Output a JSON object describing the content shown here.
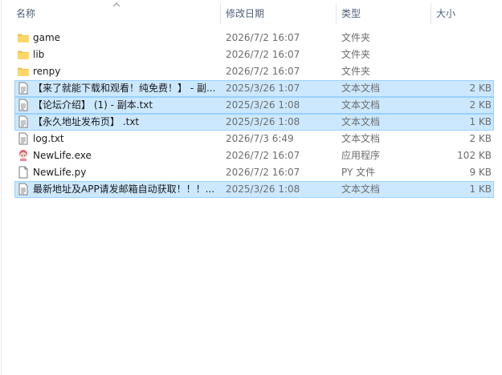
{
  "columns": {
    "name": "名称",
    "date": "修改日期",
    "type": "类型",
    "size": "大小"
  },
  "sort": {
    "column": "name",
    "direction": "ascending",
    "icon": "chevron-up-icon"
  },
  "files": [
    {
      "name": "game",
      "date": "2026/7/2 16:07",
      "type": "文件夹",
      "size": "",
      "icon": "folder-icon",
      "selected": false
    },
    {
      "name": "lib",
      "date": "2026/7/2 16:07",
      "type": "文件夹",
      "size": "",
      "icon": "folder-icon",
      "selected": false
    },
    {
      "name": "renpy",
      "date": "2026/7/2 16:07",
      "type": "文件夹",
      "size": "",
      "icon": "folder-icon",
      "selected": false
    },
    {
      "name": "【来了就能下载和观看！纯免费！】 - 副...",
      "date": "2025/3/26 1:07",
      "type": "文本文档",
      "size": "2 KB",
      "icon": "text-file-icon",
      "selected": true
    },
    {
      "name": "【论坛介绍】 (1) - 副本.txt",
      "date": "2025/3/26 1:08",
      "type": "文本文档",
      "size": "2 KB",
      "icon": "text-file-icon",
      "selected": true
    },
    {
      "name": "【永久地址发布页】 .txt",
      "date": "2025/3/26 1:08",
      "type": "文本文档",
      "size": "1 KB",
      "icon": "text-file-icon",
      "selected": true
    },
    {
      "name": "log.txt",
      "date": "2026/7/3 6:49",
      "type": "文本文档",
      "size": "2 KB",
      "icon": "text-file-icon",
      "selected": false
    },
    {
      "name": "NewLife.exe",
      "date": "2026/7/2 16:07",
      "type": "应用程序",
      "size": "102 KB",
      "icon": "app-icon",
      "selected": false
    },
    {
      "name": "NewLife.py",
      "date": "2026/7/2 16:07",
      "type": "PY 文件",
      "size": "9 KB",
      "icon": "blank-file-icon",
      "selected": false
    },
    {
      "name": "最新地址及APP请发邮箱自动获取！！！...",
      "date": "2025/3/26 1:08",
      "type": "文本文档",
      "size": "1 KB",
      "icon": "text-file-icon",
      "selected": true
    }
  ],
  "colors": {
    "selection_bg": "#cce8ff",
    "selection_border": "#99d1ff",
    "header_text": "#4c607a",
    "folder_yellow": "#ffd766"
  }
}
